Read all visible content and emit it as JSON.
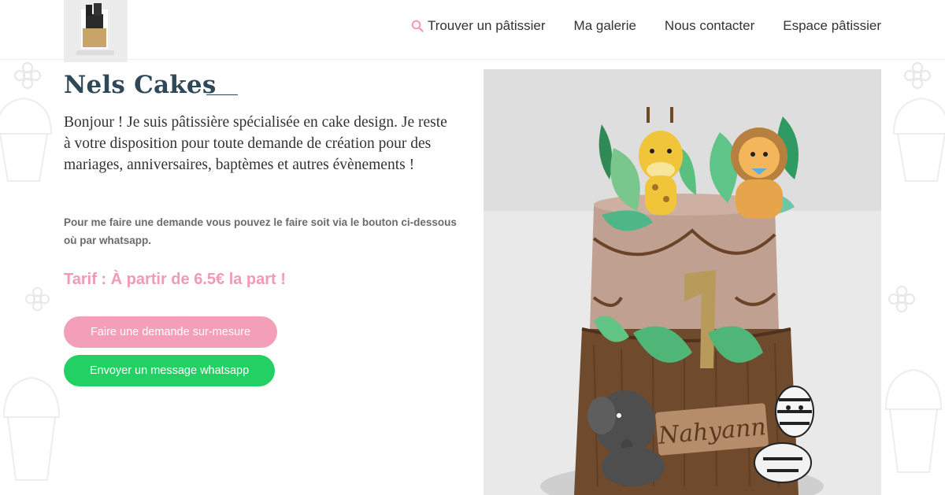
{
  "header": {
    "logo_alt": "Nels Cakes logo",
    "nav": [
      {
        "label": "Trouver un pâtissier",
        "icon": "search-icon"
      },
      {
        "label": "Ma galerie"
      },
      {
        "label": "Nous contacter"
      },
      {
        "label": "Espace pâtissier"
      }
    ]
  },
  "main": {
    "title": "Nels Cakes",
    "intro": "Bonjour ! Je suis pâtissière spécialisée en cake design. Je reste à votre disposition pour toute demande de création pour des mariages, anniversaires, baptèmes et autres évènements !",
    "note": "Pour me faire une demande vous pouvez le faire soit via le bouton ci-dessous où par whatsapp.",
    "price": "Tarif : À partir de 6.5€ la part !",
    "buttons": {
      "custom_request": "Faire une demande sur-mesure",
      "whatsapp": "Envoyer un message whatsapp"
    },
    "photo_alt": "Jungle themed layered cake with giraffe, lion, elephant and zebra figurines",
    "cake_plaque_text": "Nahyann"
  },
  "colors": {
    "title": "#2f4858",
    "accent_pink": "#f39fb7",
    "price_pink": "#f19ab4",
    "whatsapp_green": "#23d064"
  }
}
